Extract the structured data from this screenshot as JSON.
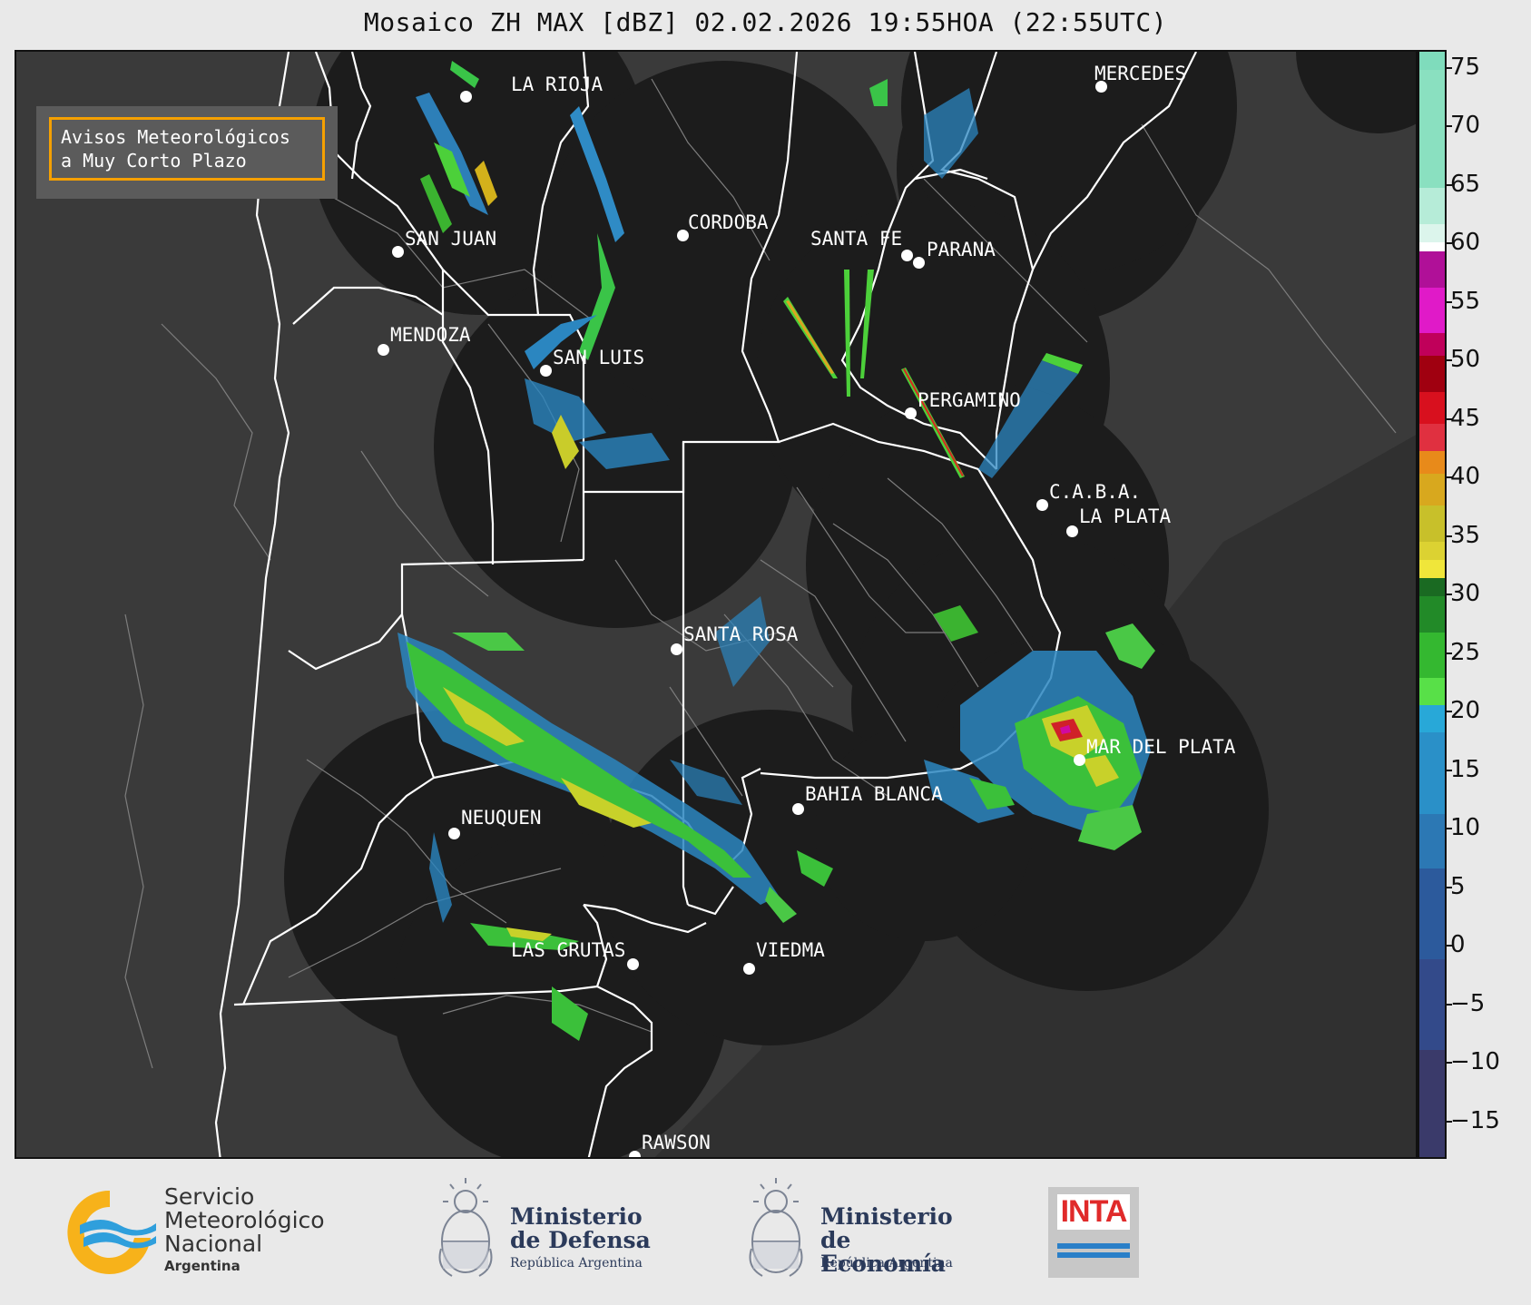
{
  "title": "Mosaico ZH MAX [dBZ] 02.02.2026 19:55HOA (22:55UTC)",
  "avisos": {
    "line1": "Avisos Meteorológicos",
    "line2": "a Muy Corto Plazo"
  },
  "cities": [
    {
      "id": "la-rioja",
      "name": "LA RIOJA"
    },
    {
      "id": "mercedes",
      "name": "MERCEDES"
    },
    {
      "id": "cordoba",
      "name": "CORDOBA"
    },
    {
      "id": "san-juan",
      "name": "SAN JUAN"
    },
    {
      "id": "santa-fe",
      "name": "SANTA FE"
    },
    {
      "id": "parana",
      "name": "PARANA"
    },
    {
      "id": "mendoza",
      "name": "MENDOZA"
    },
    {
      "id": "san-luis",
      "name": "SAN LUIS"
    },
    {
      "id": "pergamino",
      "name": "PERGAMINO"
    },
    {
      "id": "caba",
      "name": "C.A.B.A."
    },
    {
      "id": "la-plata",
      "name": "LA PLATA"
    },
    {
      "id": "santa-rosa",
      "name": "SANTA ROSA"
    },
    {
      "id": "mar-del-plata",
      "name": "MAR DEL PLATA"
    },
    {
      "id": "bahia-blanca",
      "name": "BAHIA BLANCA"
    },
    {
      "id": "neuquen",
      "name": "NEUQUEN"
    },
    {
      "id": "las-grutas",
      "name": "LAS GRUTAS"
    },
    {
      "id": "viedma",
      "name": "VIEDMA"
    },
    {
      "id": "rawson",
      "name": "RAWSON"
    }
  ],
  "colorbar": {
    "unit": "dBZ",
    "ticks": [
      "75",
      "70",
      "65",
      "60",
      "55",
      "50",
      "45",
      "40",
      "35",
      "30",
      "25",
      "20",
      "15",
      "10",
      "5",
      "0",
      "−5",
      "−10",
      "−15"
    ]
  },
  "footer": {
    "smn": {
      "line1": "Servicio",
      "line2": "Meteorológico",
      "line3": "Nacional",
      "line4": "Argentina"
    },
    "defensa": {
      "line1": "Ministerio",
      "line2": "de Defensa",
      "line3": "República Argentina"
    },
    "economia": {
      "line1": "Ministerio",
      "line2": "de Economía",
      "line3": "República Argentina"
    },
    "inta": {
      "label": "INTA"
    }
  }
}
